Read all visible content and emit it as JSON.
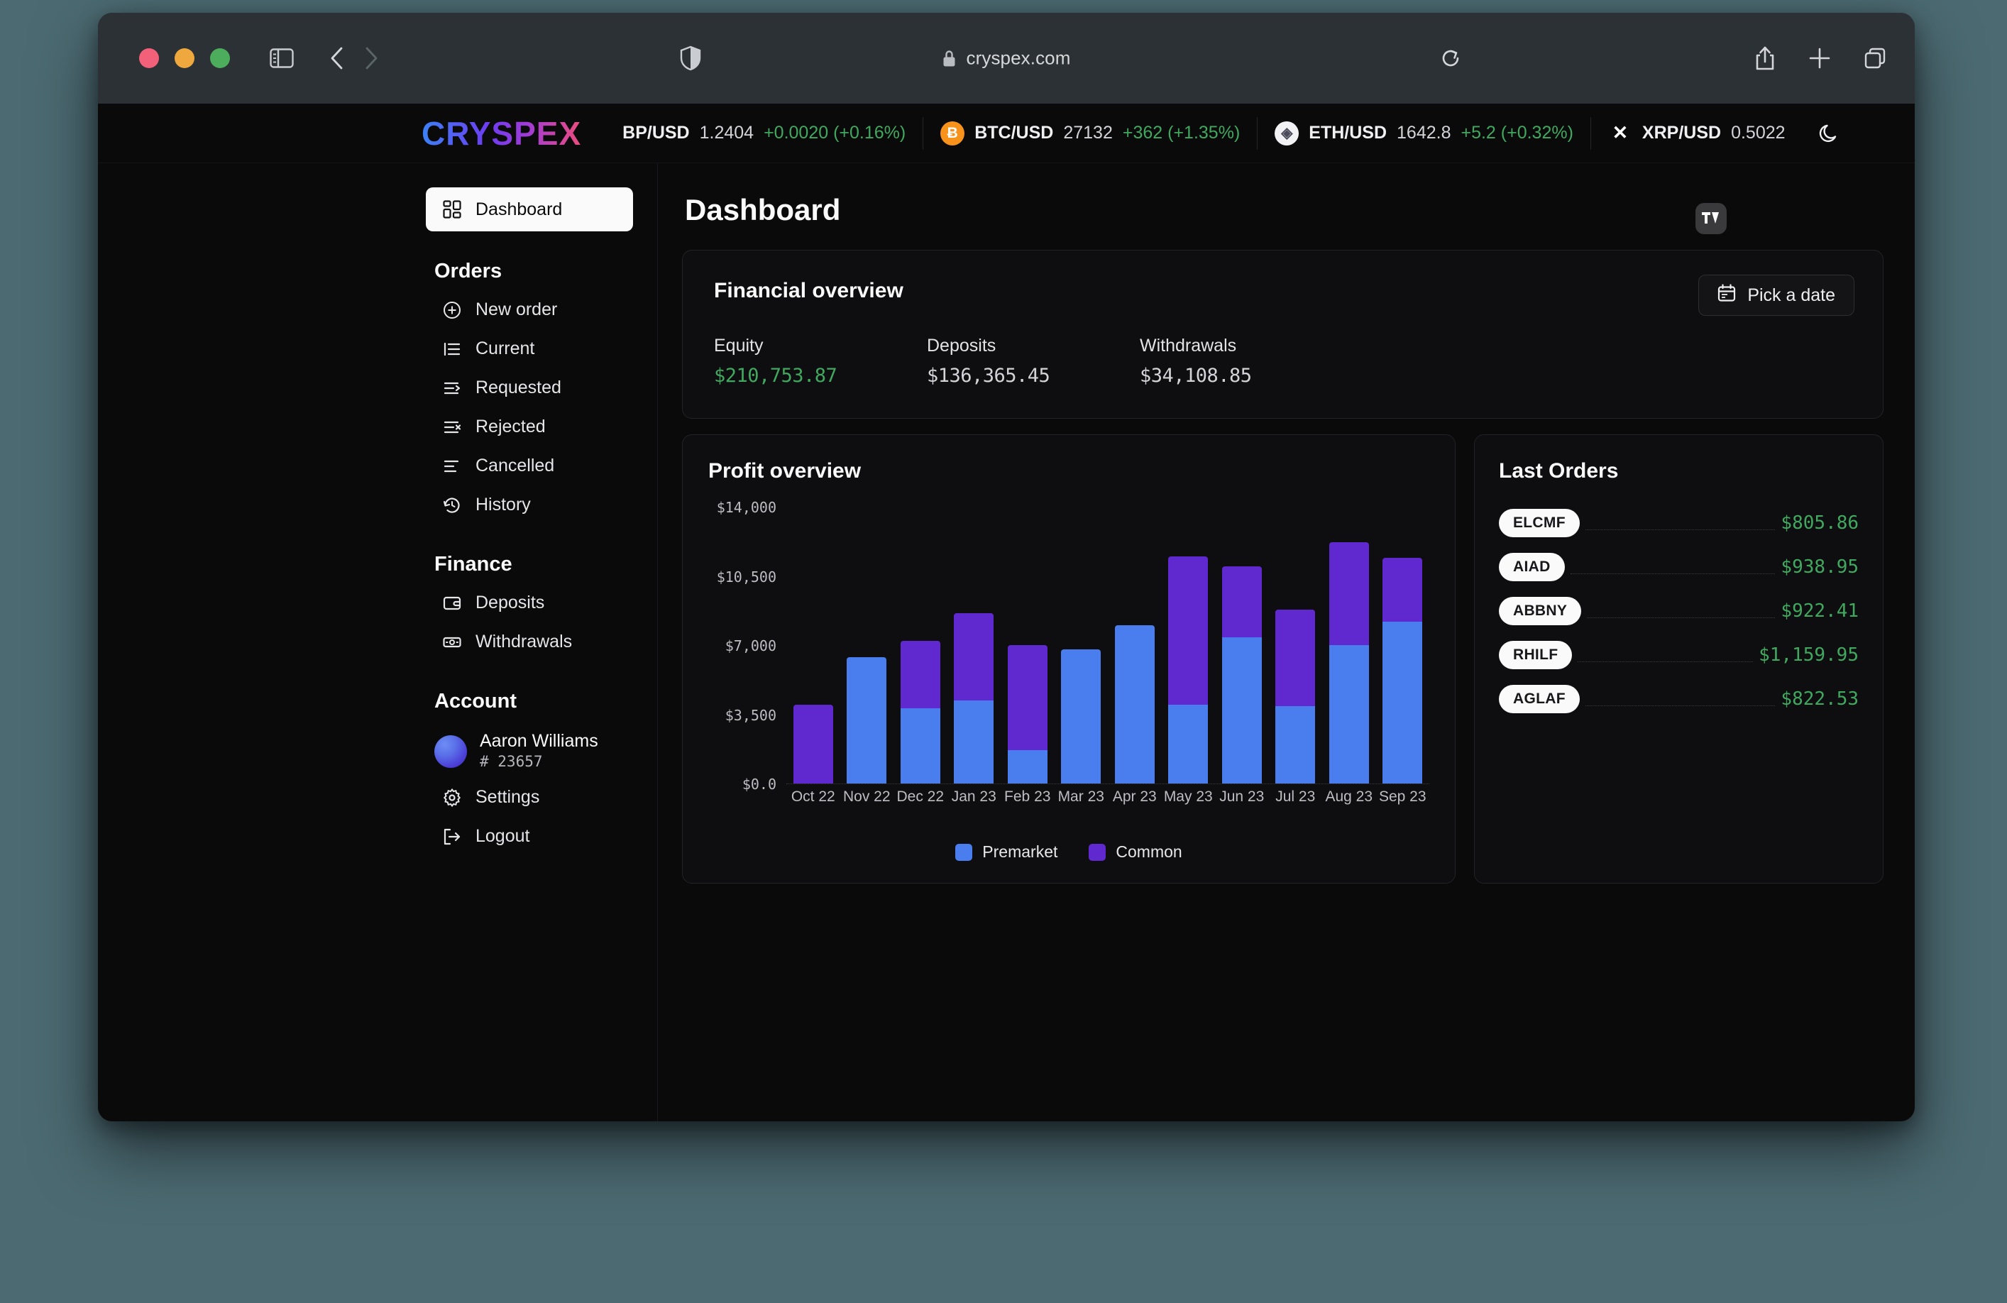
{
  "browser": {
    "url": "cryspex.com",
    "icons": {
      "sidebar": "sidebar-toggle-icon",
      "back": "back-arrow-icon",
      "forward": "forward-arrow-icon",
      "shield": "privacy-shield-icon",
      "lock": "lock-icon",
      "reload": "reload-icon",
      "share": "share-icon",
      "newtab": "plus-icon",
      "tabs": "tab-overview-icon"
    }
  },
  "ticker": {
    "logo": "CRYSPEX",
    "items": [
      {
        "icon": "",
        "symbol": "BP/USD",
        "price": "1.2404",
        "change": "+0.0020 (+0.16%)"
      },
      {
        "icon": "Ƀ",
        "symbol": "BTC/USD",
        "price": "27132",
        "change": "+362 (+1.35%)"
      },
      {
        "icon": "◈",
        "symbol": "ETH/USD",
        "price": "1642.8",
        "change": "+5.2 (+0.32%)"
      },
      {
        "icon": "✕",
        "symbol": "XRP/USD",
        "price": "0.5022",
        "change": ""
      }
    ],
    "tradingview_badge": "TV",
    "theme_toggle": "moon-icon"
  },
  "sidebar": {
    "active": {
      "label": "Dashboard",
      "icon": "dashboard-grid-icon"
    },
    "sections": [
      {
        "title": "Orders",
        "items": [
          {
            "label": "New order",
            "icon": "plus-circle-icon"
          },
          {
            "label": "Current",
            "icon": "list-current-icon"
          },
          {
            "label": "Requested",
            "icon": "list-arrow-icon"
          },
          {
            "label": "Rejected",
            "icon": "list-x-icon"
          },
          {
            "label": "Cancelled",
            "icon": "list-minus-icon"
          },
          {
            "label": "History",
            "icon": "history-clock-icon"
          }
        ]
      },
      {
        "title": "Finance",
        "items": [
          {
            "label": "Deposits",
            "icon": "wallet-icon"
          },
          {
            "label": "Withdrawals",
            "icon": "banknote-icon"
          }
        ]
      }
    ],
    "account": {
      "title": "Account",
      "user_name": "Aaron Williams",
      "user_id": "# 23657",
      "items": [
        {
          "label": "Settings",
          "icon": "gear-icon"
        },
        {
          "label": "Logout",
          "icon": "logout-icon"
        }
      ]
    }
  },
  "main": {
    "page_title": "Dashboard",
    "financial": {
      "title": "Financial overview",
      "pick_date_label": "Pick a date",
      "pick_date_icon": "calendar-icon",
      "stats": [
        {
          "label": "Equity",
          "value": "$210,753.87",
          "positive": true
        },
        {
          "label": "Deposits",
          "value": "$136,365.45",
          "positive": false
        },
        {
          "label": "Withdrawals",
          "value": "$34,108.85",
          "positive": false
        }
      ]
    },
    "profit": {
      "title": "Profit overview"
    },
    "orders": {
      "title": "Last Orders",
      "rows": [
        {
          "ticker": "ELCMF",
          "amount": "$805.86"
        },
        {
          "ticker": "AIAD",
          "amount": "$938.95"
        },
        {
          "ticker": "ABBNY",
          "amount": "$922.41"
        },
        {
          "ticker": "RHILF",
          "amount": "$1,159.95"
        },
        {
          "ticker": "AGLAF",
          "amount": "$822.53"
        }
      ]
    }
  },
  "colors": {
    "premarket": "#4a7ded",
    "common": "#6029d0",
    "positive": "#41a85f",
    "card_bg": "#0e0e10",
    "page_bg": "#0a0a0b"
  },
  "chart_data": {
    "type": "bar",
    "title": "Profit overview",
    "stacked": true,
    "categories": [
      "Oct 22",
      "Nov 22",
      "Dec 22",
      "Jan 23",
      "Feb 23",
      "Mar 23",
      "Apr 23",
      "May 23",
      "Jun 23",
      "Jul 23",
      "Aug 23",
      "Sep 23"
    ],
    "series": [
      {
        "name": "Premarket",
        "color": "#4a7ded",
        "values": [
          0,
          6400,
          3800,
          4200,
          1700,
          6800,
          8000,
          4000,
          7400,
          3900,
          7000,
          8200
        ]
      },
      {
        "name": "Common",
        "color": "#6029d0",
        "values": [
          4000,
          0,
          3400,
          4400,
          5300,
          0,
          0,
          7500,
          3600,
          4900,
          5200,
          3200
        ]
      }
    ],
    "totals": [
      4000,
      6400,
      7200,
      8600,
      7000,
      6800,
      8000,
      11500,
      11000,
      8800,
      12200,
      11400
    ],
    "ylabel": "",
    "xlabel": "",
    "ylim": [
      0,
      14000
    ],
    "yticks": [
      "$0.0",
      "$3,500",
      "$7,000",
      "$10,500",
      "$14,000"
    ],
    "ytick_values": [
      0,
      3500,
      7000,
      10500,
      14000
    ],
    "grid": false,
    "legend_position": "bottom"
  }
}
